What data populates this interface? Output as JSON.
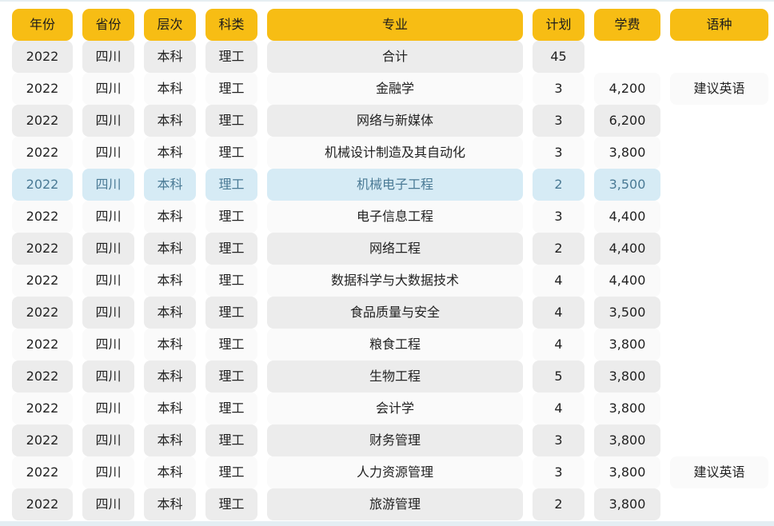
{
  "table": {
    "headers": [
      "年份",
      "省份",
      "层次",
      "科类",
      "专业",
      "计划",
      "学费",
      "语种"
    ],
    "rows": [
      {
        "year": "2022",
        "province": "四川",
        "level": "本科",
        "category": "理工",
        "major": "合计",
        "plan": "45",
        "fee": "",
        "language": ""
      },
      {
        "year": "2022",
        "province": "四川",
        "level": "本科",
        "category": "理工",
        "major": "金融学",
        "plan": "3",
        "fee": "4,200",
        "language": "建议英语"
      },
      {
        "year": "2022",
        "province": "四川",
        "level": "本科",
        "category": "理工",
        "major": "网络与新媒体",
        "plan": "3",
        "fee": "6,200",
        "language": ""
      },
      {
        "year": "2022",
        "province": "四川",
        "level": "本科",
        "category": "理工",
        "major": "机械设计制造及其自动化",
        "plan": "3",
        "fee": "3,800",
        "language": ""
      },
      {
        "year": "2022",
        "province": "四川",
        "level": "本科",
        "category": "理工",
        "major": "机械电子工程",
        "plan": "2",
        "fee": "3,500",
        "language": ""
      },
      {
        "year": "2022",
        "province": "四川",
        "level": "本科",
        "category": "理工",
        "major": "电子信息工程",
        "plan": "3",
        "fee": "4,400",
        "language": ""
      },
      {
        "year": "2022",
        "province": "四川",
        "level": "本科",
        "category": "理工",
        "major": "网络工程",
        "plan": "2",
        "fee": "4,400",
        "language": ""
      },
      {
        "year": "2022",
        "province": "四川",
        "level": "本科",
        "category": "理工",
        "major": "数据科学与大数据技术",
        "plan": "4",
        "fee": "4,400",
        "language": ""
      },
      {
        "year": "2022",
        "province": "四川",
        "level": "本科",
        "category": "理工",
        "major": "食品质量与安全",
        "plan": "4",
        "fee": "3,500",
        "language": ""
      },
      {
        "year": "2022",
        "province": "四川",
        "level": "本科",
        "category": "理工",
        "major": "粮食工程",
        "plan": "4",
        "fee": "3,800",
        "language": ""
      },
      {
        "year": "2022",
        "province": "四川",
        "level": "本科",
        "category": "理工",
        "major": "生物工程",
        "plan": "5",
        "fee": "3,800",
        "language": ""
      },
      {
        "year": "2022",
        "province": "四川",
        "level": "本科",
        "category": "理工",
        "major": "会计学",
        "plan": "4",
        "fee": "3,800",
        "language": ""
      },
      {
        "year": "2022",
        "province": "四川",
        "level": "本科",
        "category": "理工",
        "major": "财务管理",
        "plan": "3",
        "fee": "3,800",
        "language": ""
      },
      {
        "year": "2022",
        "province": "四川",
        "level": "本科",
        "category": "理工",
        "major": "人力资源管理",
        "plan": "3",
        "fee": "3,800",
        "language": "建议英语"
      },
      {
        "year": "2022",
        "province": "四川",
        "level": "本科",
        "category": "理工",
        "major": "旅游管理",
        "plan": "2",
        "fee": "3,800",
        "language": ""
      }
    ]
  },
  "colors": {
    "header_bg": "#f7bd14",
    "row_shade": "#ececec",
    "row_plain": "#fafafa",
    "row_highlight": "#d6ebf5",
    "highlight_text": "#4a7a95"
  }
}
